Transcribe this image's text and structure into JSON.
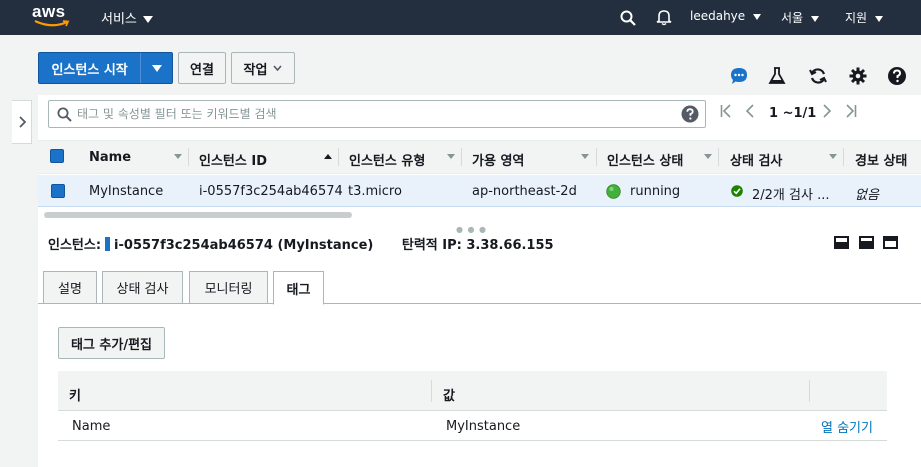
{
  "nav": {
    "logo_text": "aws",
    "services_label": "서비스",
    "user_label": "leedahye",
    "region_label": "서울",
    "support_label": "지원"
  },
  "toolbar": {
    "launch_label": "인스턴스 시작",
    "connect_label": "연결",
    "actions_label": "작업"
  },
  "filter": {
    "placeholder": "태그 및 속성별 필터 또는 키워드별 검색",
    "pager_text": "1 ~1/1"
  },
  "table": {
    "columns": [
      "Name",
      "인스턴스 ID",
      "인스턴스 유형",
      "가용 영역",
      "인스턴스 상태",
      "상태 검사",
      "경보 상태"
    ],
    "rows": [
      {
        "name": "MyInstance",
        "instance_id": "i-0557f3c254ab46574",
        "type": "t3.micro",
        "az": "ap-northeast-2d",
        "state": "running",
        "status_check": "2/2개 검사 ...",
        "alarm": "없음"
      }
    ]
  },
  "detail": {
    "instance_label": "인스턴스:",
    "instance_value": "i-0557f3c254ab46574 (MyInstance)",
    "eip_label": "탄력적 IP:",
    "eip_value": "3.38.66.155",
    "tabs": [
      "설명",
      "상태 검사",
      "모니터링",
      "태그"
    ],
    "active_tab": "태그",
    "add_tag_label": "태그 추가/편집",
    "tag_columns": [
      "키",
      "값"
    ],
    "tags": [
      {
        "key": "Name",
        "value": "MyInstance"
      }
    ],
    "hide_column_label": "열 숨기기"
  },
  "colors": {
    "nav_bg": "#232f3e",
    "primary": "#1a73c8",
    "running_green": "#44b03c",
    "link": "#0073bb"
  }
}
